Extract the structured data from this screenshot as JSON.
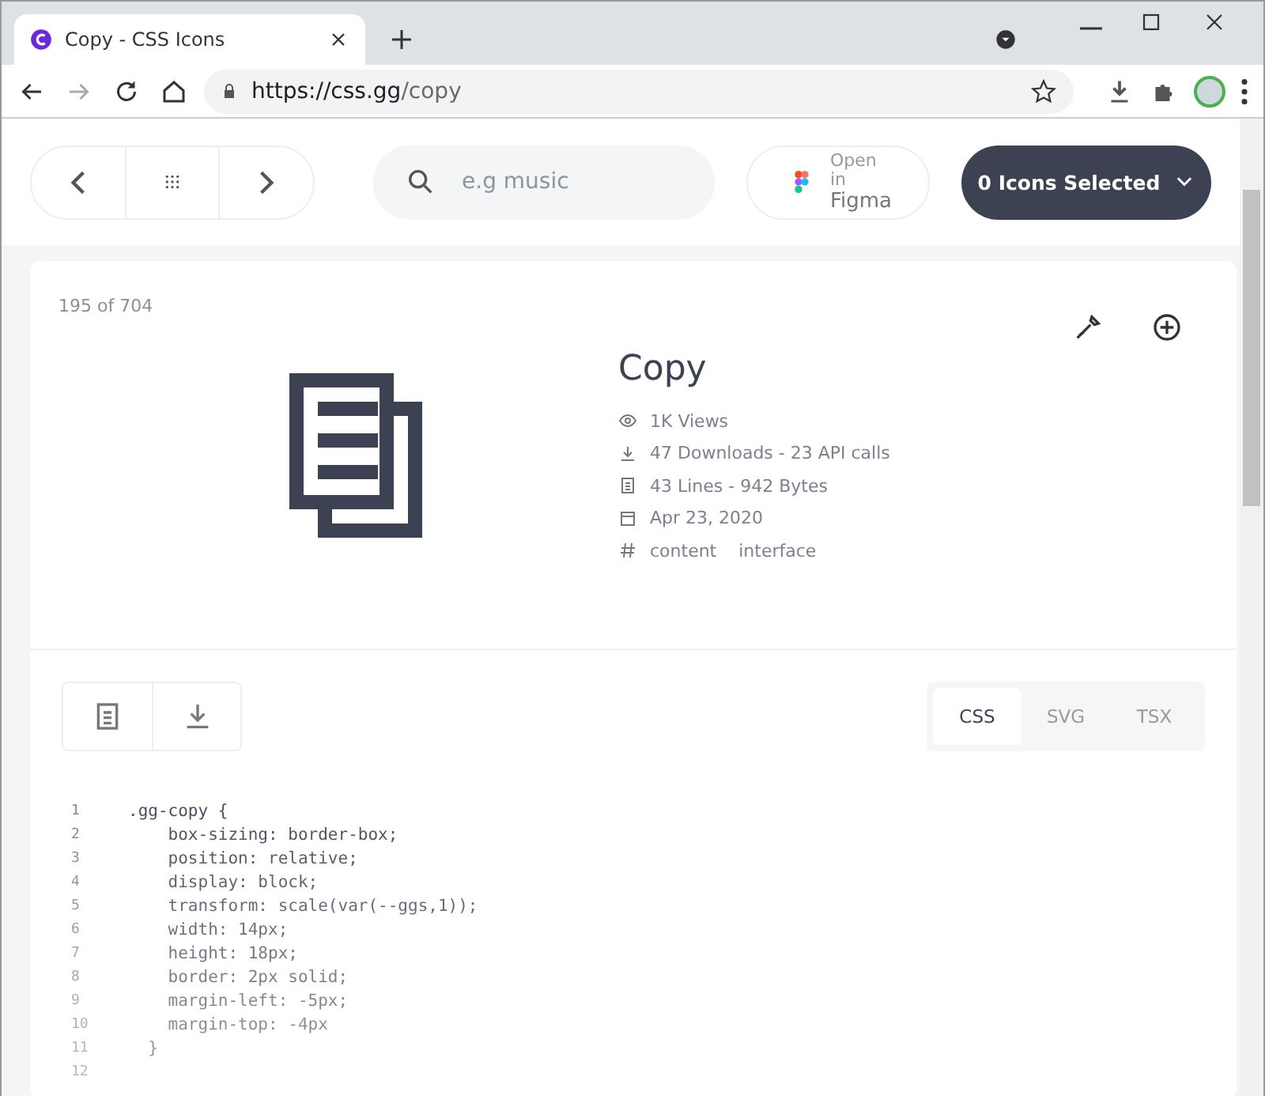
{
  "browser": {
    "tab_title": "Copy - CSS Icons",
    "url_host": "https://css.gg",
    "url_path": "/copy"
  },
  "toolbar": {
    "search": {
      "placeholder": "e.g music"
    },
    "figma": {
      "line1": "Open",
      "line2": "in",
      "line3": "Figma"
    },
    "selected_button": "0 Icons Selected"
  },
  "detail": {
    "position": "195 of 704",
    "title": "Copy",
    "meta": [
      {
        "kind": "views",
        "text": "1K Views"
      },
      {
        "kind": "downloads",
        "text": "47 Downloads - 23 API calls"
      },
      {
        "kind": "size",
        "text": "43 Lines - 942 Bytes"
      },
      {
        "kind": "date",
        "text": "Apr 23, 2020"
      },
      {
        "kind": "tags",
        "tags": [
          "content",
          "interface"
        ]
      }
    ]
  },
  "code_tabs": [
    {
      "label": "CSS",
      "selected": true
    },
    {
      "label": "SVG",
      "selected": false
    },
    {
      "label": "TSX",
      "selected": false
    }
  ],
  "code_lines": [
    {
      "number": "1",
      "code": ".gg-copy {"
    },
    {
      "number": "2",
      "code": "    box-sizing: border-box;"
    },
    {
      "number": "3",
      "code": "    position: relative;"
    },
    {
      "number": "4",
      "code": "    display: block;"
    },
    {
      "number": "5",
      "code": "    transform: scale(var(--ggs,1));"
    },
    {
      "number": "6",
      "code": "    width: 14px;"
    },
    {
      "number": "7",
      "code": "    height: 18px;"
    },
    {
      "number": "8",
      "code": "    border: 2px solid;"
    },
    {
      "number": "9",
      "code": "    margin-left: -5px;"
    },
    {
      "number": "10",
      "code": "    margin-top: -4px"
    },
    {
      "number": "11",
      "code": "  }"
    },
    {
      "number": "12"
    }
  ]
}
